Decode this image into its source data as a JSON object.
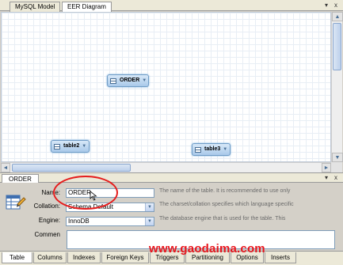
{
  "top_tabs": [
    {
      "label": "MySQL Model"
    },
    {
      "label": "EER Diagram"
    }
  ],
  "window_buttons": {
    "dropdown": "▾",
    "close": "x"
  },
  "diagram": {
    "tables": [
      {
        "name": "ORDER"
      },
      {
        "name": "table2"
      },
      {
        "name": "table3"
      }
    ]
  },
  "editor": {
    "tab_label": "ORDER",
    "name_label": "Name:",
    "name_value": "ORDER",
    "name_help": "The name of the table. It is recommended to use only",
    "collation_label": "Collation:",
    "collation_value": "Schema Default",
    "collation_help": "The charset/collation specifies which language specific",
    "engine_label": "Engine:",
    "engine_value": "InnoDB",
    "engine_help": "The database engine that is used for the table. This",
    "comments_label": "Commen",
    "comments_value": ""
  },
  "bottom_tabs": [
    "Table",
    "Columns",
    "Indexes",
    "Foreign Keys",
    "Triggers",
    "Partitioning",
    "Options",
    "Inserts"
  ],
  "active_bottom_tab": "Table",
  "watermark": "www.gaodaima.com",
  "colors": {
    "accent_circle": "#e51d1d",
    "watermark": "#e8141b",
    "node_fill": "#a9c9ea"
  }
}
